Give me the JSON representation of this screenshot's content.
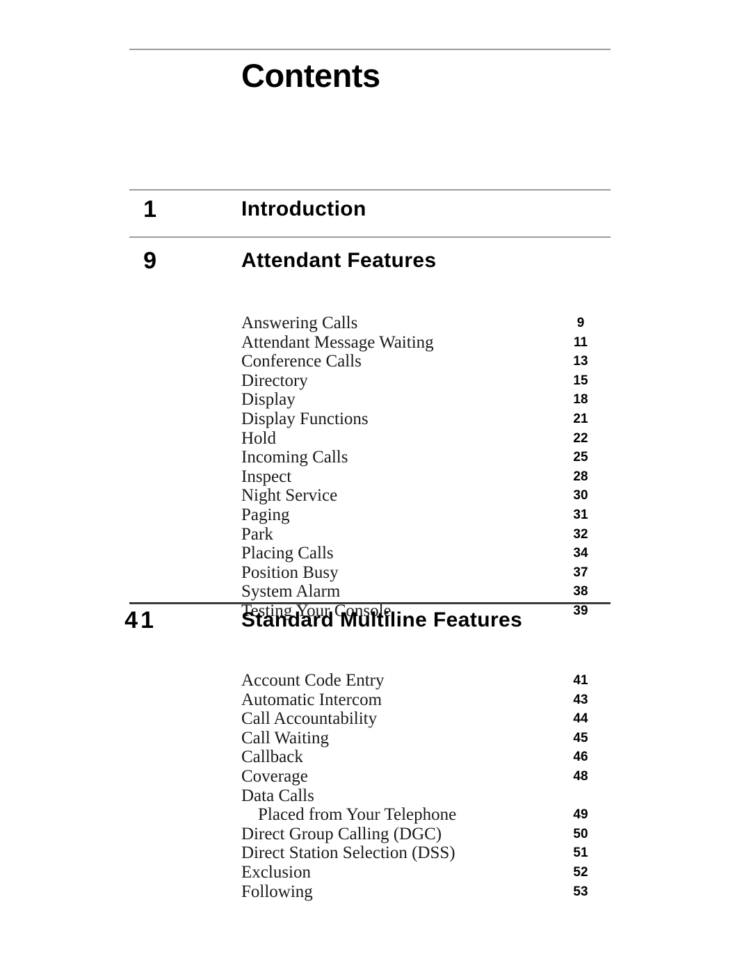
{
  "page": {
    "title": "Contents",
    "background_color": "#ffffff",
    "text_color": "#000000",
    "rule_color": "#9a9a9a",
    "rule_color_dark": "#3a3a3a"
  },
  "sections": [
    {
      "number": "1",
      "title": "Introduction",
      "entries": []
    },
    {
      "number": "9",
      "title": "Attendant  Features",
      "entries": [
        {
          "label": "Answering Calls",
          "page": "9"
        },
        {
          "label": "Attendant  Message  Waiting",
          "page": "11"
        },
        {
          "label": "Conference Calls",
          "page": "13"
        },
        {
          "label": "Directory",
          "page": "15"
        },
        {
          "label": "Display",
          "page": "18"
        },
        {
          "label": "Display Functions",
          "page": "21"
        },
        {
          "label": "Hold",
          "page": "22"
        },
        {
          "label": "Incoming  Calls",
          "page": "25"
        },
        {
          "label": "Inspect",
          "page": "28"
        },
        {
          "label": "Night Service",
          "page": "30"
        },
        {
          "label": "Paging",
          "page": "31"
        },
        {
          "label": "Park",
          "page": "32"
        },
        {
          "label": "Placing  Calls",
          "page": "34"
        },
        {
          "label": "Position Busy",
          "page": "37"
        },
        {
          "label": "System  Alarm",
          "page": "38"
        },
        {
          "label": "Testing  Your  Console",
          "page": "39"
        }
      ]
    },
    {
      "number": "41",
      "title": "Standard  Multiline  Features",
      "entries": [
        {
          "label": "Account Code Entry",
          "page": "41"
        },
        {
          "label": "Automatic Intercom",
          "page": "43"
        },
        {
          "label": "Call  Accountability",
          "page": "44"
        },
        {
          "label": "Call  Waiting",
          "page": "45"
        },
        {
          "label": "Callback",
          "page": "46"
        },
        {
          "label": "Coverage",
          "page": "48"
        },
        {
          "label": "Data Calls",
          "page": ""
        },
        {
          "label": "Placed  from  Your  Telephone",
          "page": "49",
          "indent": true
        },
        {
          "label": "Direct Group Calling (DGC)",
          "page": "50"
        },
        {
          "label": "Direct Station Selection (DSS)",
          "page": "51"
        },
        {
          "label": "Exclusion",
          "page": "52"
        },
        {
          "label": "Following",
          "page": "53"
        }
      ]
    }
  ]
}
